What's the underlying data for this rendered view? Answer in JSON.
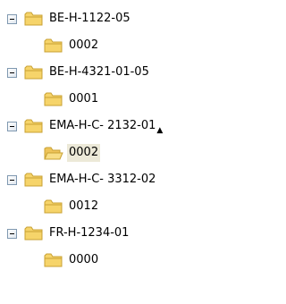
{
  "tree": {
    "nodes": [
      {
        "label": "BE-H-1122-05",
        "expanded": true,
        "children": [
          {
            "label": "0002"
          }
        ]
      },
      {
        "label": "BE-H-4321-01-05",
        "expanded": true,
        "children": [
          {
            "label": "0001"
          }
        ]
      },
      {
        "label": "EMA-H-C- 2132-01",
        "expanded": true,
        "children": [
          {
            "label": "0002",
            "selected": true
          }
        ]
      },
      {
        "label": "EMA-H-C- 3312-02",
        "expanded": true,
        "children": [
          {
            "label": "0012"
          }
        ]
      },
      {
        "label": "FR-H-1234-01",
        "expanded": true,
        "children": [
          {
            "label": "0000"
          }
        ]
      }
    ]
  },
  "colors": {
    "folder_fill": "#f6d46a",
    "folder_outline": "#c8a133",
    "selection_background": "#ece9d8"
  },
  "icons": {
    "toggle": "collapse-minus-icon",
    "folder": "folder-icon",
    "mouse_cursor": "mouse-pointer-icon"
  }
}
